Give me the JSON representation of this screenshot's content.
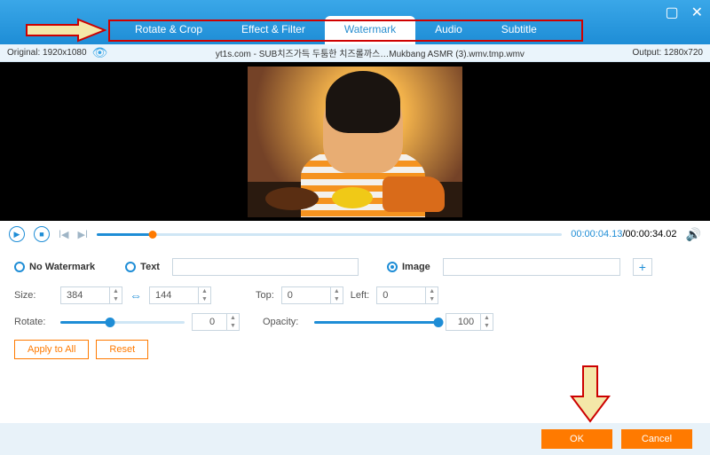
{
  "titlebar": {
    "tabs": [
      {
        "label": "Rotate & Crop"
      },
      {
        "label": "Effect & Filter"
      },
      {
        "label": "Watermark"
      },
      {
        "label": "Audio"
      },
      {
        "label": "Subtitle"
      }
    ]
  },
  "infobar": {
    "original": "Original: 1920x1080",
    "filename": "yt1s.com - SUB치즈가득 두툼한 치즈롤까스…Mukbang ASMR (3).wmv.tmp.wmv",
    "output": "Output: 1280x720"
  },
  "playback": {
    "current_time": "00:00:04.13",
    "total_time": "00:00:34.02"
  },
  "watermark": {
    "no_watermark_label": "No Watermark",
    "text_label": "Text",
    "text_value": "",
    "image_label": "Image",
    "image_value": "",
    "size_label": "Size:",
    "size_w": "384",
    "size_h": "144",
    "top_label": "Top:",
    "top_value": "0",
    "left_label": "Left:",
    "left_value": "0",
    "rotate_label": "Rotate:",
    "rotate_value": "0",
    "rotate_percent": 40,
    "opacity_label": "Opacity:",
    "opacity_value": "100",
    "opacity_percent": 100,
    "apply_all": "Apply to All",
    "reset": "Reset"
  },
  "footer": {
    "ok": "OK",
    "cancel": "Cancel"
  }
}
